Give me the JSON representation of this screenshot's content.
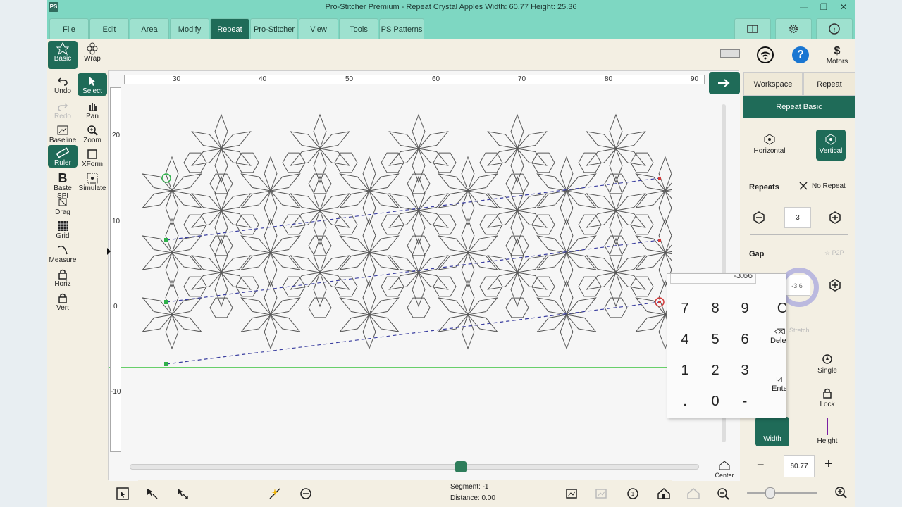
{
  "window": {
    "app_logo": "PS",
    "title": "Pro-Stitcher Premium   -   Repeat Crystal Apples   Width: 60.77   Height: 25.36",
    "min_label": "—",
    "restore_label": "❐",
    "close_label": "✕"
  },
  "menu": [
    "File",
    "Edit",
    "Area",
    "Modify",
    "Repeat",
    "Pro-Stitcher",
    "View",
    "Tools",
    "PS Patterns"
  ],
  "menu_active": "Repeat",
  "top_tools": {
    "basic": "Basic",
    "wrap": "Wrap"
  },
  "status_icons": {
    "motors_label": "Motors",
    "motors_symbol": "$",
    "help_symbol": "?"
  },
  "left_tools": [
    {
      "label": "Undo",
      "icon": "undo-icon"
    },
    {
      "label": "Select",
      "icon": "select-icon"
    },
    {
      "label": "Redo",
      "icon": "redo-icon"
    },
    {
      "label": "Pan",
      "icon": "pan-icon"
    },
    {
      "label": "Baseline",
      "icon": "baseline-icon"
    },
    {
      "label": "Zoom",
      "icon": "zoom-icon"
    },
    {
      "label": "Ruler",
      "icon": "ruler-icon"
    },
    {
      "label": "XForm",
      "icon": "xform-icon"
    },
    {
      "label": "Baste SPI",
      "icon": "baste-icon"
    },
    {
      "label": "Simulate",
      "icon": "simulate-icon"
    },
    {
      "label": "Drag",
      "icon": "drag-icon"
    },
    {
      "label": "Grid",
      "icon": "grid-icon"
    },
    {
      "label": "Measure",
      "icon": "measure-icon"
    },
    {
      "label": "Horiz",
      "icon": "horiz-lock-icon"
    },
    {
      "label": "Vert",
      "icon": "vert-lock-icon"
    }
  ],
  "ruler": {
    "h_ticks": [
      "30",
      "40",
      "50",
      "60",
      "70",
      "80",
      "90"
    ],
    "v_ticks": [
      "20",
      "10",
      "0",
      "-10"
    ]
  },
  "right_panel": {
    "tabs": [
      "Workspace",
      "Repeat"
    ],
    "header": "Repeat Basic",
    "horizontal": "Horizontal",
    "vertical": "Vertical",
    "repeats_label": "Repeats",
    "no_repeat": "No Repeat",
    "repeats_value": "3",
    "gap_label": "Gap",
    "p2p": "P2P",
    "gap_value": "-3.6",
    "stretch": "Stretch",
    "single": "Single",
    "lock": "Lock",
    "width": "Width",
    "height": "Height",
    "size_value": "60.77",
    "minus": "−",
    "plus": "+",
    "center": "Center"
  },
  "keypad": {
    "display": "-3.66",
    "keys": [
      "7",
      "8",
      "9",
      "C",
      "4",
      "5",
      "6",
      "Dele",
      "1",
      "2",
      "3",
      "Ente",
      ".",
      "0",
      "-"
    ]
  },
  "bottom": {
    "segment_label": "Segment:",
    "segment_value": "-1",
    "distance_label": "Distance:",
    "distance_value": "0.00"
  },
  "colors": {
    "teal_bar": "#7ed7c2",
    "dark_green": "#1f6b58",
    "panel_bg": "#f3efe3",
    "stitch_line": "#555555",
    "guide_line": "#3b3fa0",
    "baseline": "#39c23b",
    "start_marker": "#2fb04a",
    "end_marker": "#d23a3a"
  }
}
